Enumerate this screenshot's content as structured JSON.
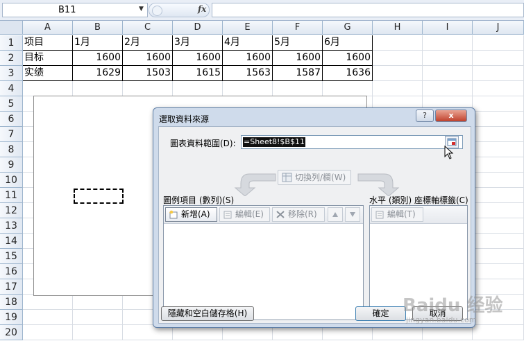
{
  "formula_bar": {
    "name_box": "B11",
    "fx": "fx",
    "formula": ""
  },
  "columns": [
    "A",
    "B",
    "C",
    "D",
    "E",
    "F",
    "G",
    "H",
    "I",
    "J"
  ],
  "rows": [
    "1",
    "2",
    "3",
    "4",
    "5",
    "6",
    "7",
    "8",
    "9",
    "10",
    "11",
    "12",
    "13",
    "14",
    "15",
    "16",
    "17",
    "18",
    "19",
    "20"
  ],
  "table": {
    "header": [
      "项目",
      "1月",
      "2月",
      "3月",
      "4月",
      "5月",
      "6月"
    ],
    "rows": [
      [
        "目标",
        "1600",
        "1600",
        "1600",
        "1600",
        "1600",
        "1600"
      ],
      [
        "实绩",
        "1629",
        "1503",
        "1615",
        "1563",
        "1587",
        "1636"
      ]
    ]
  },
  "dialog": {
    "title": "選取資料來源",
    "help": "?",
    "close": "x",
    "range_label": "圖表資料範圍(D):",
    "range_value": "=Sheet8!$B$11",
    "switch_button": "切換列/欄(W)",
    "legend_section": "圖例項目 (數列)(S)",
    "add_button": "新增(A)",
    "edit_button": "編輯(E)",
    "remove_button": "移除(R)",
    "axis_section": "水平 (類別) 座標軸標籤(C)",
    "axis_edit_button": "編輯(T)",
    "hidden_button": "隱藏和空白儲存格(H)",
    "ok_button": "確定",
    "cancel_button": "取消"
  },
  "watermark": {
    "brand": "Baidu 经验",
    "url": "jingyan.baidu.com"
  }
}
